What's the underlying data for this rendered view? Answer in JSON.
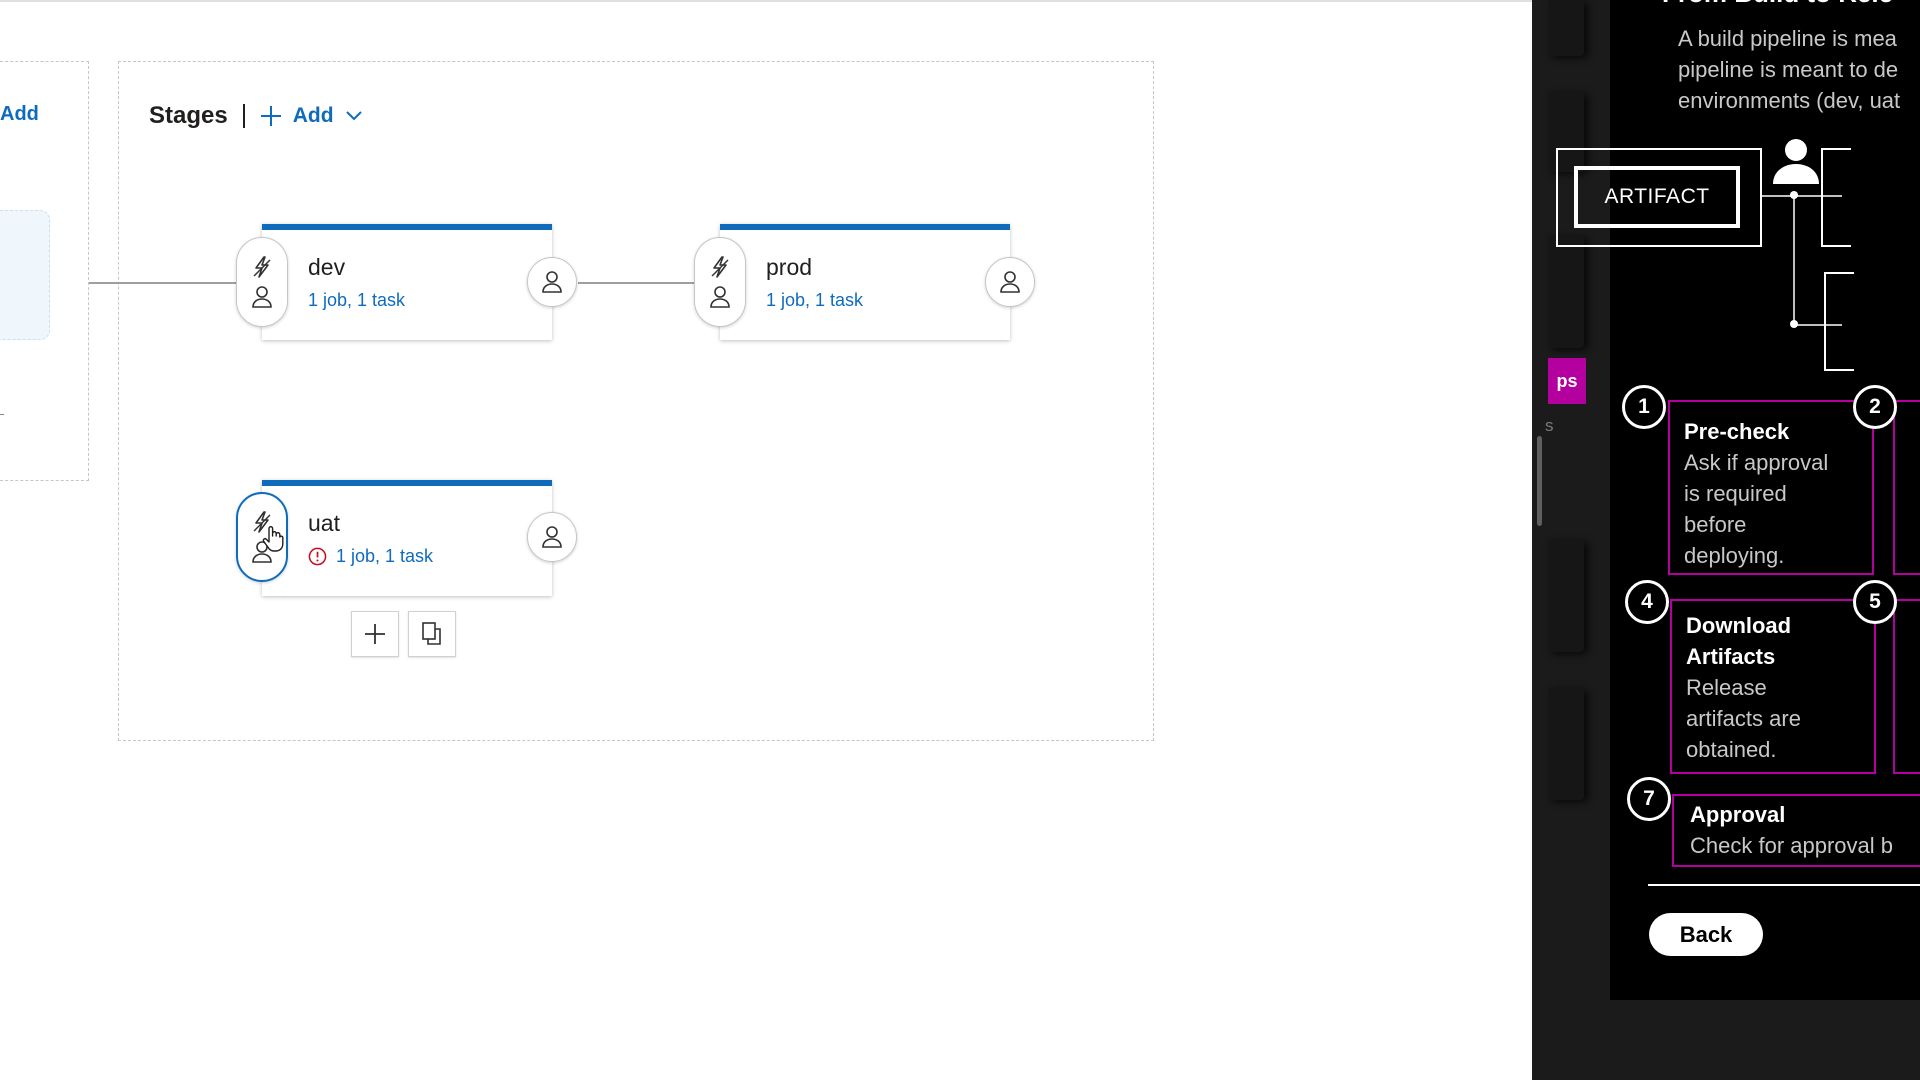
{
  "artifacts": {
    "add_label": "Add"
  },
  "stages": {
    "title": "Stages",
    "add_label": "Add",
    "items": [
      {
        "name": "dev",
        "meta": "1 job, 1 task",
        "warning": false
      },
      {
        "name": "prod",
        "meta": "1 job, 1 task",
        "warning": false
      },
      {
        "name": "uat",
        "meta": "1 job, 1 task",
        "warning": true
      }
    ]
  },
  "overlay": {
    "title": "From Build to Rele",
    "description": [
      "A build pipeline is mea",
      "pipeline is meant to de",
      "environments (dev, uat"
    ],
    "tab_label": "ps",
    "side_text": "s",
    "artifact_label": "ARTIFACT",
    "steps": [
      {
        "number": "1",
        "title": "Pre-check",
        "text": [
          "Ask if approval",
          "is required",
          "before",
          "deploying."
        ]
      },
      {
        "number": "2"
      },
      {
        "number": "4",
        "title": "Download Artifacts",
        "title_lines": [
          "Download",
          "Artifacts"
        ],
        "text": [
          "Release",
          "artifacts are",
          "obtained."
        ]
      },
      {
        "number": "5"
      },
      {
        "number": "7",
        "title": "Approval",
        "text": [
          "Check for approval b"
        ]
      }
    ],
    "back_label": "Back"
  },
  "colors": {
    "accent": "#0f6cbd",
    "stage_border": "#0f6cbd",
    "warning": "#c50f1f",
    "overlay_magenta": "#b4009e"
  },
  "icons": [
    "lightning-icon",
    "person-icon",
    "plus-icon",
    "chevron-down-icon",
    "clone-icon",
    "warning-icon",
    "hand-cursor-icon"
  ]
}
